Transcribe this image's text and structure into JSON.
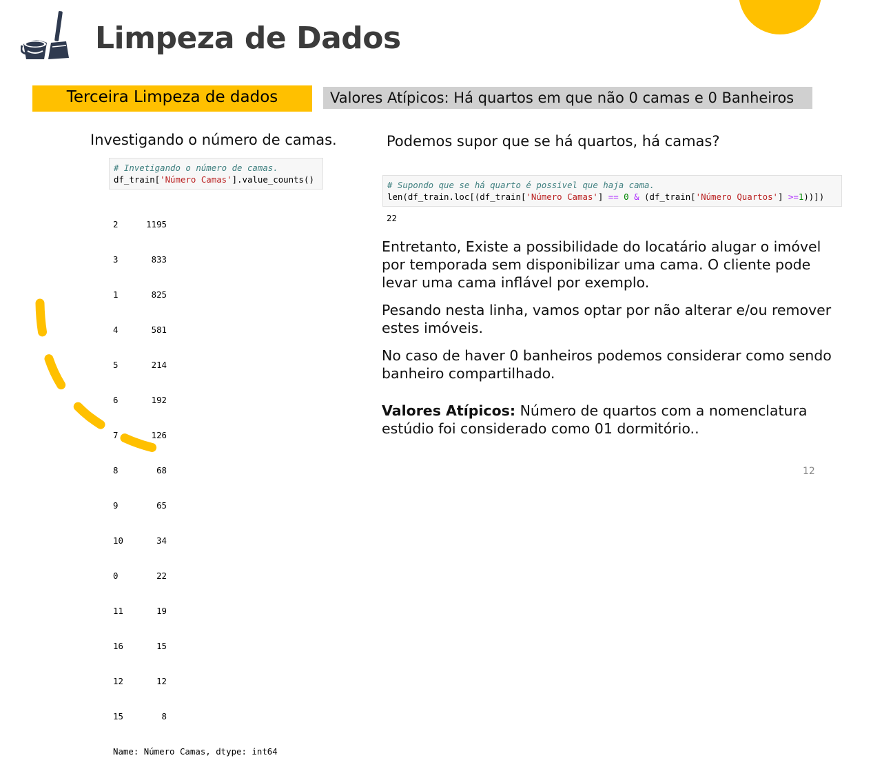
{
  "slide": {
    "title": "Limpeza de Dados",
    "page_number": "12",
    "logo_icon": "bucket-broom-icon",
    "accent_color": "#ffc000"
  },
  "tags": {
    "section": "Terceira Limpeza de dados",
    "outliers": "Valores Atípicos: Há quartos em que não 0 camas e 0 Banheiros"
  },
  "left": {
    "subtitle": "Investigando o número de camas.",
    "code_comment": "# Invetigando o número de camas.",
    "code_prefix": "df_train[",
    "code_string": "'Número Camas'",
    "code_suffix": "].value_counts()",
    "rows": [
      {
        "k": "2",
        "v": "1195"
      },
      {
        "k": "3",
        "v": "833"
      },
      {
        "k": "1",
        "v": "825"
      },
      {
        "k": "4",
        "v": "581"
      },
      {
        "k": "5",
        "v": "214"
      },
      {
        "k": "6",
        "v": "192"
      },
      {
        "k": "7",
        "v": "126"
      },
      {
        "k": "8",
        "v": "68"
      },
      {
        "k": "9",
        "v": "65"
      },
      {
        "k": "10",
        "v": "34"
      },
      {
        "k": "0",
        "v": "22"
      },
      {
        "k": "11",
        "v": "19"
      },
      {
        "k": "16",
        "v": "15"
      },
      {
        "k": "12",
        "v": "12"
      },
      {
        "k": "15",
        "v": "8"
      }
    ],
    "output_footer": "Name: Número Camas, dtype: int64"
  },
  "right": {
    "subtitle": "Podemos supor que se há quartos, há camas?",
    "code_comment": "# Supondo que se há quarto é possivel que haja cama.",
    "code_p1": "len(df_train.loc[(df_train[",
    "code_s1": "'Número Camas'",
    "code_p2": "] ",
    "code_op1": "==",
    "code_p3": " ",
    "code_n1": "0",
    "code_p4": " ",
    "code_op2": "&",
    "code_p5": " (df_train[",
    "code_s2": "'Número Quartos'",
    "code_p6": "] ",
    "code_op3": ">=",
    "code_n2": "1",
    "code_p7": "))])",
    "output": "22",
    "para1": "Entretanto, Existe a possibilidade do locatário alugar o imóvel por temporada sem disponibilizar uma cama. O cliente pode levar uma cama inflável por exemplo.",
    "para2": "Pesando nesta linha, vamos optar por não alterar e/ou remover estes imóveis.",
    "para3": "No caso de haver 0 banheiros podemos considerar como sendo banheiro compartilhado.",
    "para4_bold": "Valores Atípicos:",
    "para4_rest": " Número de quartos com a nomenclatura estúdio foi considerado como 01 dormitório.."
  }
}
